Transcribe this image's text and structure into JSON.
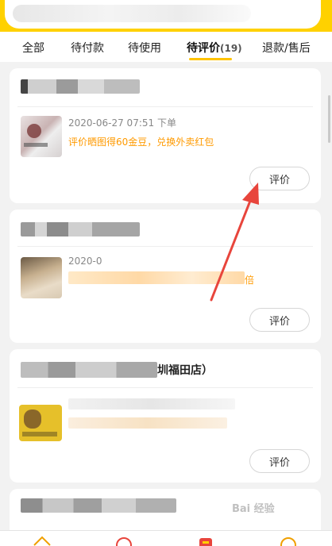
{
  "tabs": {
    "all": "全部",
    "pending_payment": "待付款",
    "to_use": "待使用",
    "to_review": "待评价",
    "to_review_count": "(19)",
    "refund": "退款/售后"
  },
  "orders": [
    {
      "time": "2020-06-27 07:51 下单",
      "promo": "评价晒图得60金豆，兑换外卖红包",
      "button": "评价"
    },
    {
      "time_partial": "2020-0",
      "promo_partial": "倍",
      "button": "评价"
    },
    {
      "shop_suffix": "圳福田店）",
      "button": "评价"
    }
  ],
  "watermark": "Bai 经验",
  "colors": {
    "brand_yellow": "#ffd100",
    "promo_orange": "#ff9a00",
    "arrow_red": "#e8453c"
  }
}
